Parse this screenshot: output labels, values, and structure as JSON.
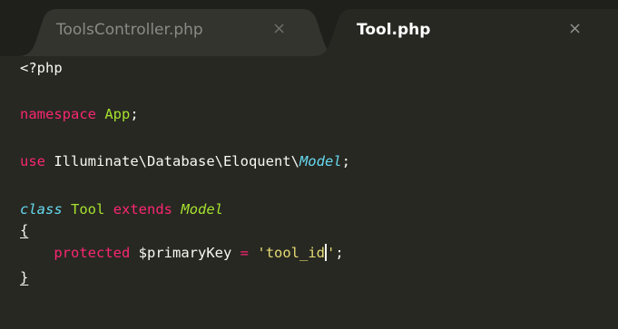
{
  "tabs": [
    {
      "label": "ToolsController.php",
      "close": "×",
      "active": false
    },
    {
      "label": "Tool.php",
      "close": "×",
      "active": true
    }
  ],
  "code": {
    "line1": {
      "text": "<?php"
    },
    "line3": {
      "kw": "namespace",
      "name": "App",
      "end": ";"
    },
    "line5": {
      "kw": "use",
      "path": "Illuminate\\Database\\Eloquent\\",
      "cls": "Model",
      "end": ";"
    },
    "line7": {
      "kw": "class",
      "name": "Tool",
      "extends": "extends",
      "parent": "Model"
    },
    "line8": {
      "brace": "{"
    },
    "line9": {
      "indent": "    ",
      "kw": "protected",
      "var": "$primaryKey",
      "op": "=",
      "str_before_cursor": "'tool_id",
      "str_after_cursor": "'",
      "end": ";"
    },
    "line10": {
      "brace": "}"
    }
  },
  "colors": {
    "background": "#272822",
    "tabbar": "#1f201b",
    "keyword_pink": "#f92672",
    "keyword_cyan": "#66d9ef",
    "class_green": "#a6e22e",
    "string_yellow": "#e6db74",
    "text_default": "#f8f8f2"
  }
}
